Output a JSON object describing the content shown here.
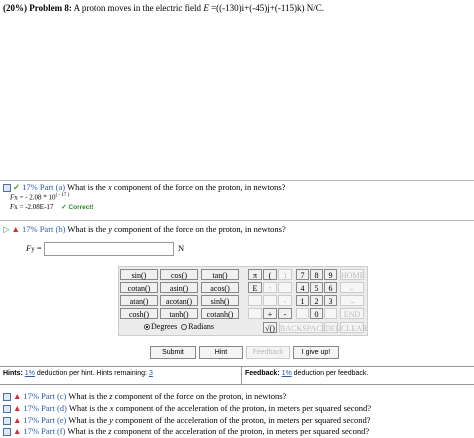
{
  "problem": {
    "prefix": "(20%)",
    "name": "Problem 8:",
    "text": "A proton moves in the electric field",
    "field_symbol": "E",
    "eq": "=((-130)",
    "i": "i",
    "plus1": "+(-45)",
    "j": "j",
    "plus2": "+(-115)",
    "k": "k)",
    "unit": "N/C."
  },
  "part_a": {
    "percent": "17%",
    "label": "Part (a)",
    "question_pre": "What is the",
    "var": "x",
    "question_post": "component of the force on the proton, in newtons?",
    "line1_lhs": "F",
    "line1_sub": "x",
    "line1_rhs": "= - 2.08 * 10",
    "line1_exp": "( - 17 )",
    "line2_lhs": "F",
    "line2_sub": "x",
    "line2_rhs": "= -2.08E-17",
    "correct": "✓ Correct!"
  },
  "part_b": {
    "percent": "17%",
    "label": "Part (b)",
    "question_pre": "What is the",
    "var": "y",
    "question_post": "component of the force on the proton, in newtons?",
    "lhs": "F",
    "sub": "y",
    "eq": "=",
    "unit": "N"
  },
  "keypad": {
    "funcs": [
      [
        "sin()",
        "cos()",
        "tan()"
      ],
      [
        "cotan()",
        "asin()",
        "acos()"
      ],
      [
        "atan()",
        "acotan()",
        "sinh()"
      ],
      [
        "cosh()",
        "tanh()",
        "cotanh()"
      ]
    ],
    "consts": [
      [
        "π",
        "("
      ],
      [
        "E",
        "↑"
      ],
      [
        "",
        ""
      ],
      [
        "",
        "+"
      ]
    ],
    "rparen": ")",
    "digits": [
      [
        "7",
        "8",
        "9"
      ],
      [
        "4",
        "5",
        "6"
      ],
      [
        "1",
        "2",
        "3"
      ]
    ],
    "zero": "0",
    "ops": [
      "HOME",
      "←",
      "→",
      "END"
    ],
    "minus": "-",
    "dot": ".",
    "sqrt": "√()",
    "backspace": "BACKSPACE",
    "del": "DEL",
    "clear": "CLEAR",
    "degrees": "Degrees",
    "radians": "Radians"
  },
  "buttons": {
    "submit": "Submit",
    "hint": "Hint",
    "feedback": "Feedback",
    "give_up": "I give up!"
  },
  "hints": {
    "label": "Hints:",
    "pct": "1%",
    "text": "deduction per hint. Hints remaining:",
    "remaining": "3",
    "fb_label": "Feedback:",
    "fb_pct": "1%",
    "fb_text": "deduction per feedback."
  },
  "parts_rest": [
    {
      "percent": "17%",
      "label": "Part (c)",
      "pre": "What is the",
      "var": "z",
      "post": "component of the force on the proton, in newtons?"
    },
    {
      "percent": "17%",
      "label": "Part (d)",
      "pre": "What is the",
      "var": "x",
      "post": "component of the acceleration of the proton, in meters per squared second?"
    },
    {
      "percent": "17%",
      "label": "Part (e)",
      "pre": "What is the",
      "var": "y",
      "post": "component of the acceleration of the proton, in meters per squared second?"
    },
    {
      "percent": "17%",
      "label": "Part (f)",
      "pre": "What is the",
      "var": "z",
      "post": "component of the acceleration of the proton, in meters per squared second?"
    }
  ]
}
